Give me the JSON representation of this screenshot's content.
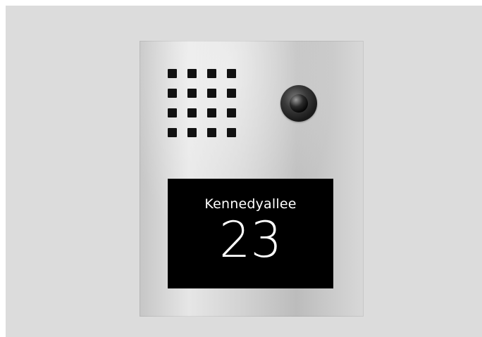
{
  "device": {
    "type": "stainless-steel door intercom panel",
    "display": {
      "street": "Kennedyallee",
      "house_number": "23"
    },
    "speaker_grille": {
      "rows": 4,
      "cols": 4
    },
    "camera": {
      "icon": "camera-icon"
    },
    "colors": {
      "background": "#dcdcdc",
      "panel": "#d0d0d0",
      "display": "#000000",
      "text": "#ffffff"
    }
  }
}
